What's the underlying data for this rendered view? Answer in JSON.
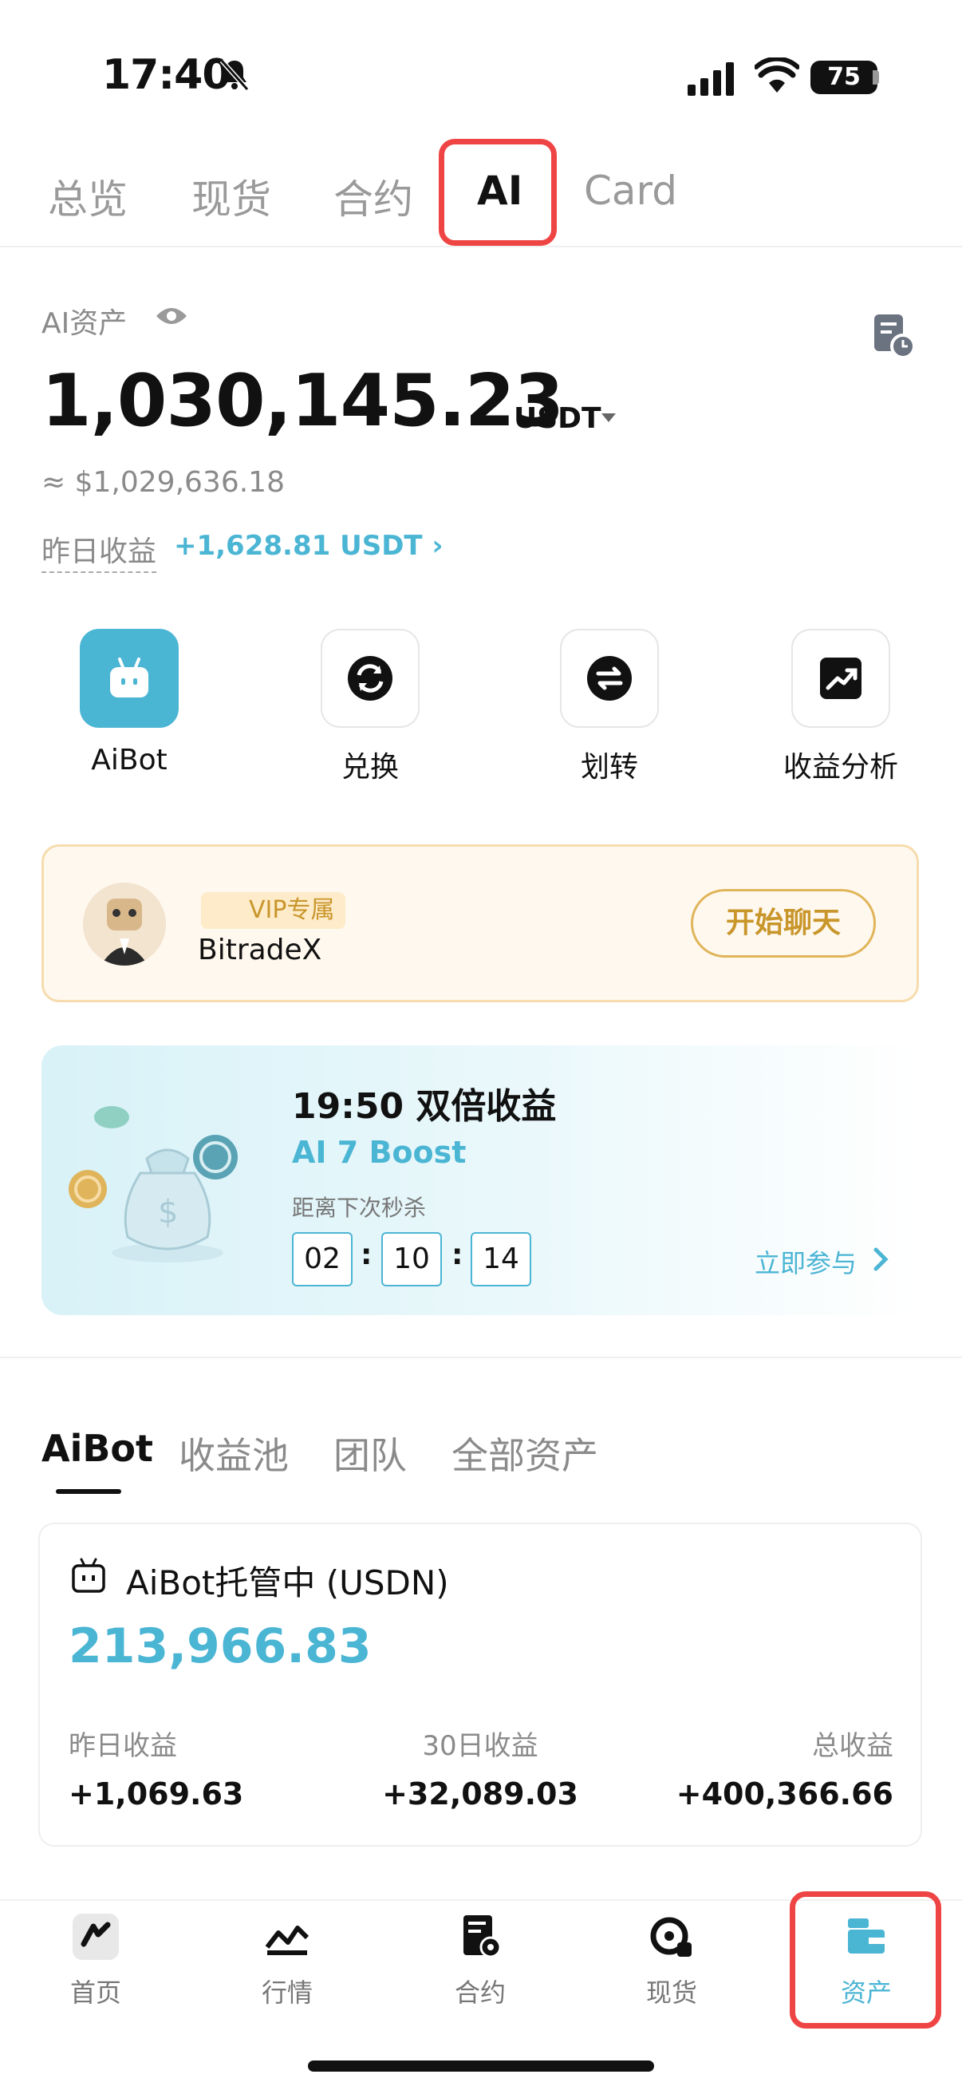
{
  "status_bar": {
    "time": "17:40",
    "battery": "75"
  },
  "top_tabs": [
    "总览",
    "现货",
    "合约",
    "AI",
    "Card"
  ],
  "asset": {
    "label": "AI资产",
    "amount": "1,030,145.23",
    "unit": "USDT",
    "approx": "≈ $1,029,636.18",
    "yesterday_label": "昨日收益",
    "yesterday_value": "+1,628.81 USDT ›"
  },
  "quick_actions": [
    {
      "label": "AiBot",
      "icon": "robot-icon"
    },
    {
      "label": "兑换",
      "icon": "exchange-icon"
    },
    {
      "label": "划转",
      "icon": "transfer-icon"
    },
    {
      "label": "收益分析",
      "icon": "trend-icon"
    }
  ],
  "vip": {
    "badge": "VIP专属",
    "name": "BitradeX",
    "button": "开始聊天"
  },
  "boost": {
    "title": "19:50  双倍收益",
    "subtitle": "AI 7 Boost",
    "countdown_label": "距离下次秒杀",
    "hours": "02",
    "minutes": "10",
    "seconds": "14",
    "link": "立即参与"
  },
  "sub_tabs": [
    "AiBot",
    "收益池",
    "团队",
    "全部资产"
  ],
  "bot_card": {
    "title": "AiBot托管中 (USDN)",
    "value": "213,966.83",
    "stats": [
      {
        "label": "昨日收益",
        "value": "+1,069.63"
      },
      {
        "label": "30日收益",
        "value": "+32,089.03"
      },
      {
        "label": "总收益",
        "value": "+400,366.66"
      }
    ]
  },
  "bottom_nav": [
    {
      "label": "首页",
      "icon": "home-icon"
    },
    {
      "label": "行情",
      "icon": "market-icon"
    },
    {
      "label": "合约",
      "icon": "contract-icon"
    },
    {
      "label": "现货",
      "icon": "spot-icon"
    },
    {
      "label": "资产",
      "icon": "assets-icon"
    }
  ],
  "colors": {
    "accent": "#4bb5d4",
    "highlight": "#ef4444",
    "gold": "#c9962b"
  }
}
